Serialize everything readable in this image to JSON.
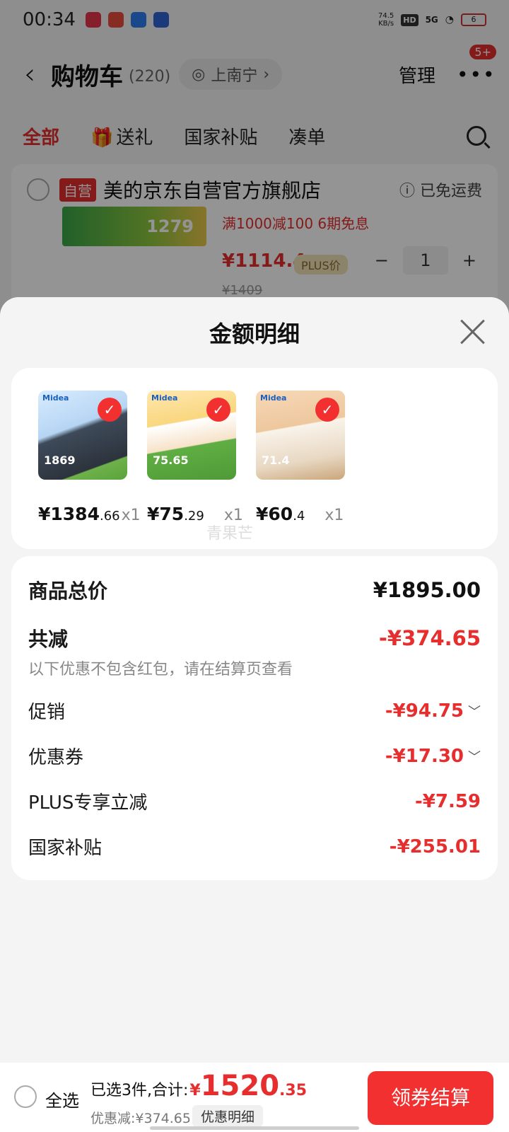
{
  "status_bar": {
    "time": "00:34",
    "net_speed_value": "74.5",
    "net_speed_unit": "KB/s",
    "hd": "HD",
    "signal": "5G",
    "battery": "6"
  },
  "nav": {
    "title": "购物车",
    "count": "(220)",
    "location": "上南宁",
    "manage": "管理",
    "more_badge": "5+"
  },
  "tabs": [
    "全部",
    "送礼",
    "国家补贴",
    "凑单"
  ],
  "store": {
    "self_tag": "自营",
    "name": "美的京东自营官方旗舰店",
    "shipping": "已免运费",
    "banner_price": "1279",
    "promo": "满1000减100  6期免息",
    "price": "¥1114.4",
    "plus_tag": "PLUS价",
    "qty": "1",
    "orig_price": "¥1409"
  },
  "sheet": {
    "title": "金额明细",
    "watermark": "青果芒",
    "products": [
      {
        "price_main": "¥1384",
        "price_dec": ".66",
        "qty": "x1",
        "thumb_label": "1869",
        "brand": "Midea"
      },
      {
        "price_main": "¥75",
        "price_dec": ".29",
        "qty": "x1",
        "thumb_label": "75.65",
        "brand": "Midea"
      },
      {
        "price_main": "¥60",
        "price_dec": ".4",
        "qty": "x1",
        "thumb_label": "71.4",
        "brand": "Midea"
      }
    ],
    "summary": {
      "total_label": "商品总价",
      "total_value": "¥1895.00",
      "reduce_label": "共减",
      "reduce_value": "-¥374.65",
      "reduce_note": "以下优惠不包含红包，请在结算页查看",
      "promo_label": "促销",
      "promo_value": "-¥94.75",
      "coupon_label": "优惠券",
      "coupon_value": "-¥17.30",
      "plus_label": "PLUS专享立减",
      "plus_value": "-¥7.59",
      "subsidy_label": "国家补贴",
      "subsidy_value": "-¥255.01"
    }
  },
  "bottom_bar": {
    "select_all": "全选",
    "total_label": "已选3件,合计:",
    "currency": "¥",
    "amount": "1520",
    "amount_dec": ".35",
    "discount": "优惠减:¥374.65",
    "detail_button": "优惠明细",
    "checkout": "领券结算"
  },
  "colors": {
    "accent_red": "#e62e2e",
    "checkout_red": "#f23030"
  }
}
